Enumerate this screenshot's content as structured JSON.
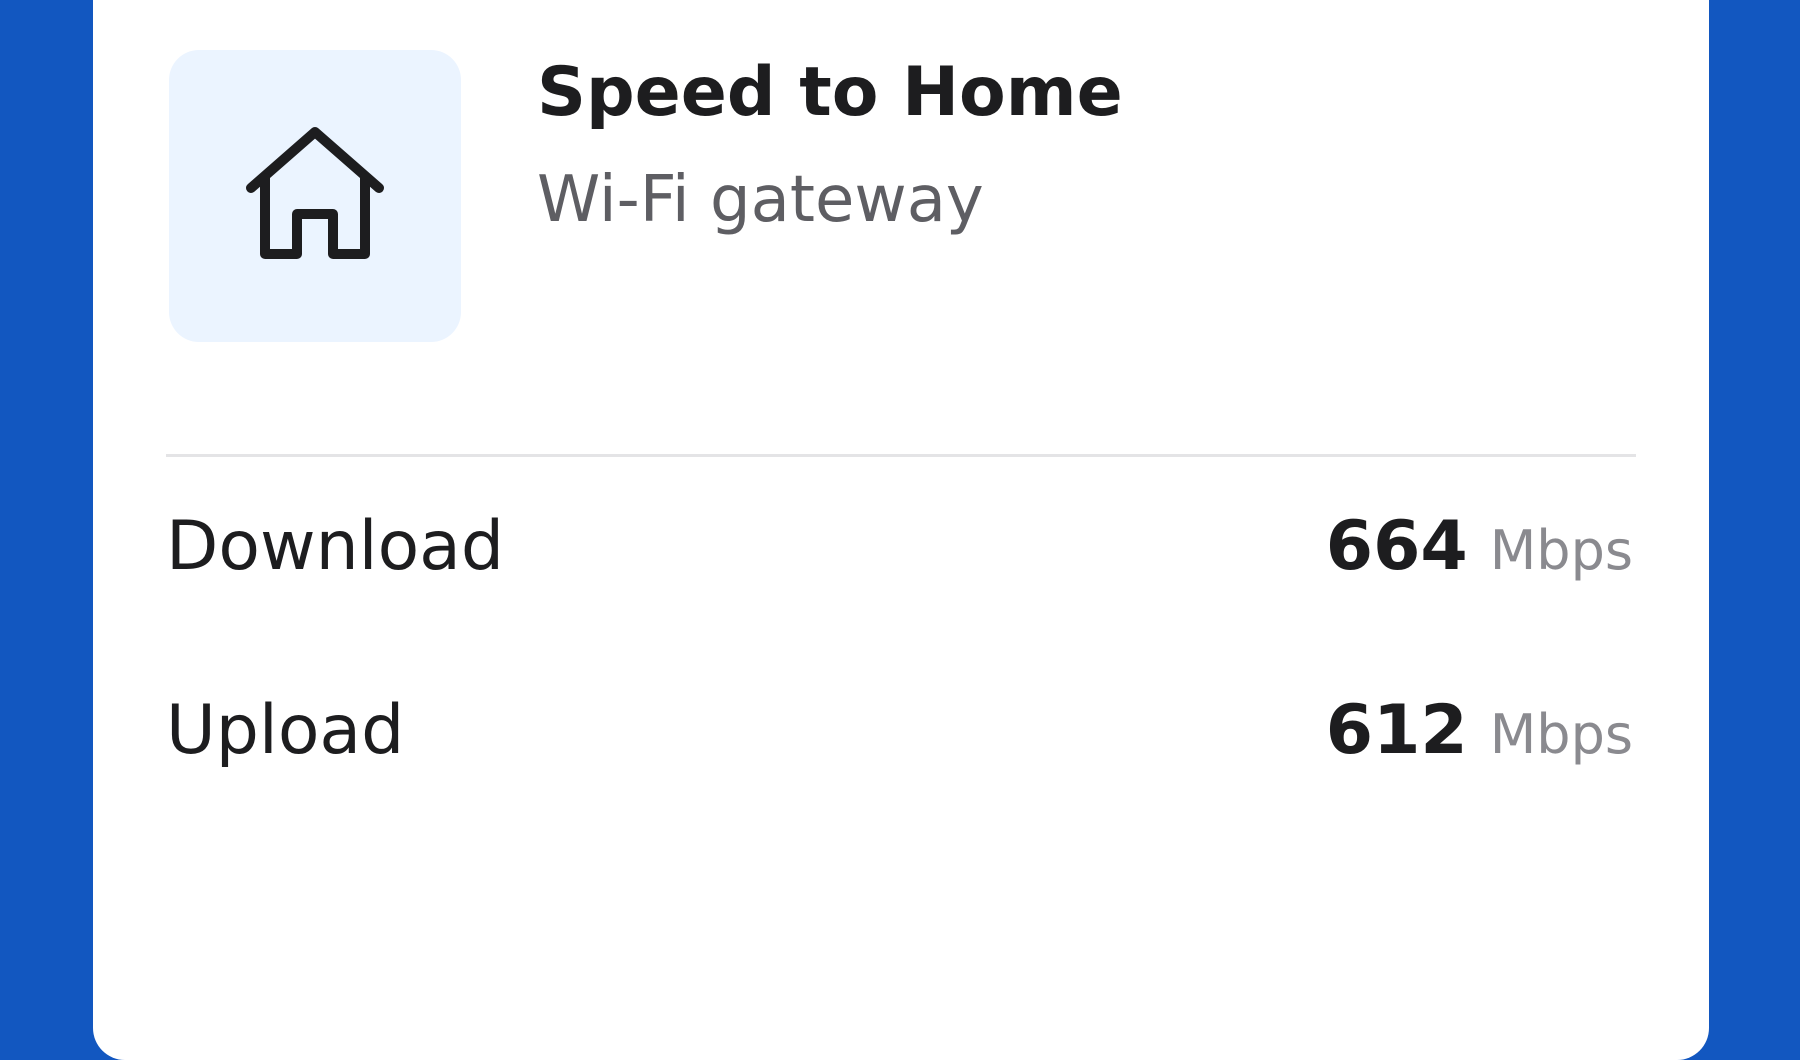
{
  "header": {
    "title": "Speed to Home",
    "subtitle": "Wi-Fi gateway",
    "icon": "home-icon"
  },
  "speeds": [
    {
      "label": "Download",
      "value": "664",
      "unit": "Mbps"
    },
    {
      "label": "Upload",
      "value": "612",
      "unit": "Mbps"
    }
  ],
  "colors": {
    "background": "#1257c0",
    "card": "#ffffff",
    "icon_tile": "#ebf4ff",
    "text_primary": "#1d1d1f",
    "text_secondary": "#5e5e63",
    "unit_text": "#8a8a8f"
  }
}
